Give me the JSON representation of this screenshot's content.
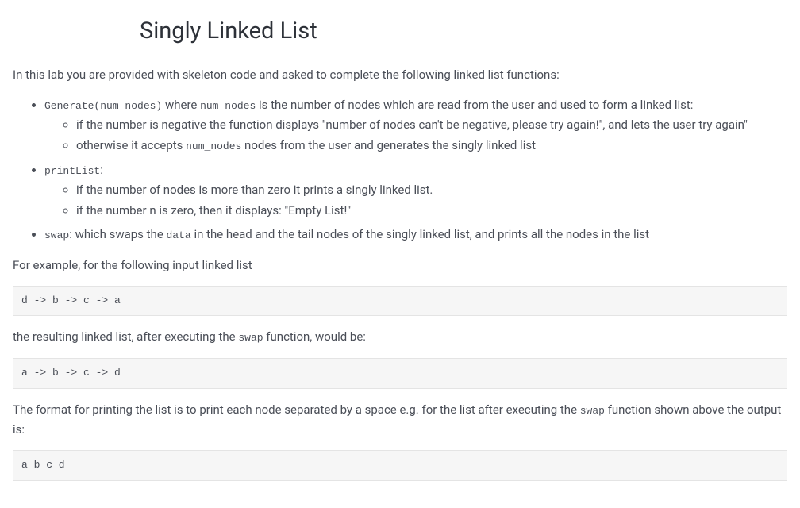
{
  "title": "Singly Linked List",
  "intro": "In this lab you are provided with skeleton code and asked to complete the following linked list functions:",
  "bullets": {
    "generate": {
      "code": "Generate(num_nodes)",
      "text1": " where ",
      "code2": "num_nodes",
      "text2": " is the number of nodes which are read from the user and used to form a linked list:",
      "sub1": "if the number is negative the function displays \"number of nodes can't be negative, please try again!\", and lets the user try again\"",
      "sub2_pre": "otherwise it accepts ",
      "sub2_code": "num_nodes",
      "sub2_post": " nodes from the user and generates the singly linked list"
    },
    "printList": {
      "code": "printList",
      "colon": ":",
      "sub1": "if the number of nodes is more than zero it prints a singly linked list.",
      "sub2": "if the number n is zero, then it displays: \"Empty List!\""
    },
    "swap": {
      "code": "swap",
      "text1": ": which swaps the ",
      "code2": "data",
      "text2": " in the head and the tail nodes of the singly linked list, and prints all the nodes in the list"
    }
  },
  "example_intro": "For example, for the following input linked list",
  "code_block1": "d -> b -> c -> a",
  "result_text_pre": "the resulting linked list, after executing the ",
  "result_code": "swap",
  "result_text_post": " function, would be:",
  "code_block2": "a -> b -> c -> d",
  "format_text_pre": "The format for printing the list is to print each node separated by a space e.g. for the list after executing the ",
  "format_code": "swap",
  "format_text_post": " function shown above the output is:",
  "code_block3": "a b c d"
}
